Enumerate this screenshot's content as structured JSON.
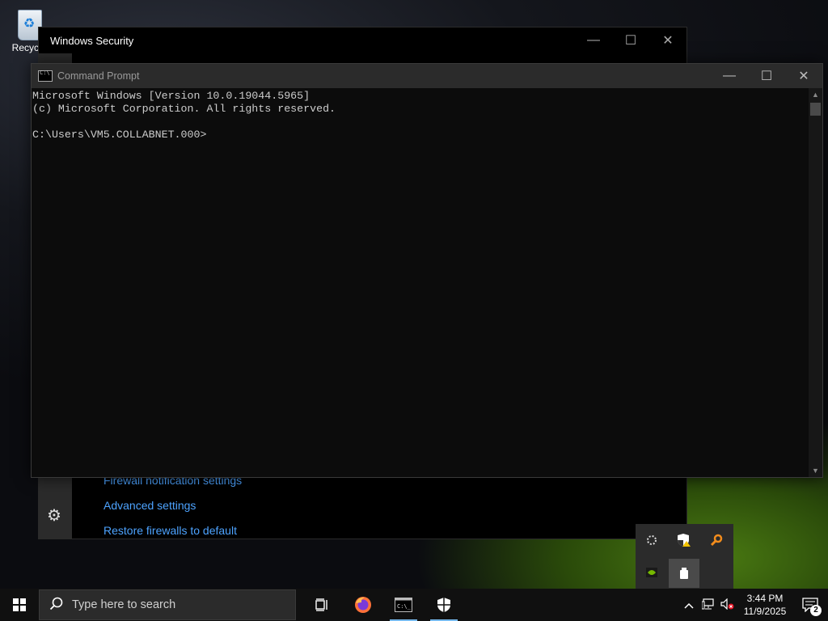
{
  "desktop": {
    "recycle_bin_label": "Recycle"
  },
  "windows_security": {
    "title": "Windows Security",
    "links": [
      "Firewall notification settings",
      "Advanced settings",
      "Restore firewalls to default"
    ]
  },
  "cmd": {
    "title": "Command Prompt",
    "lines": [
      "Microsoft Windows [Version 10.0.19044.5965]",
      "(c) Microsoft Corporation. All rights reserved.",
      "",
      "C:\\Users\\VM5.COLLABNET.000>"
    ]
  },
  "tray_flyout": {
    "icons": [
      "nvidia-icon",
      "security-warning-icon",
      "magnifier-icon",
      "nvidia-settings-icon",
      "usb-eject-icon"
    ]
  },
  "taskbar": {
    "search_placeholder": "Type here to search",
    "time": "3:44 PM",
    "date": "11/9/2025",
    "notification_count": "2",
    "pinned": [
      "task-view-icon",
      "firefox-icon",
      "command-prompt-icon",
      "windows-security-icon"
    ]
  },
  "colors": {
    "link": "#4da3ff",
    "accent_underline": "#76b9ed"
  }
}
